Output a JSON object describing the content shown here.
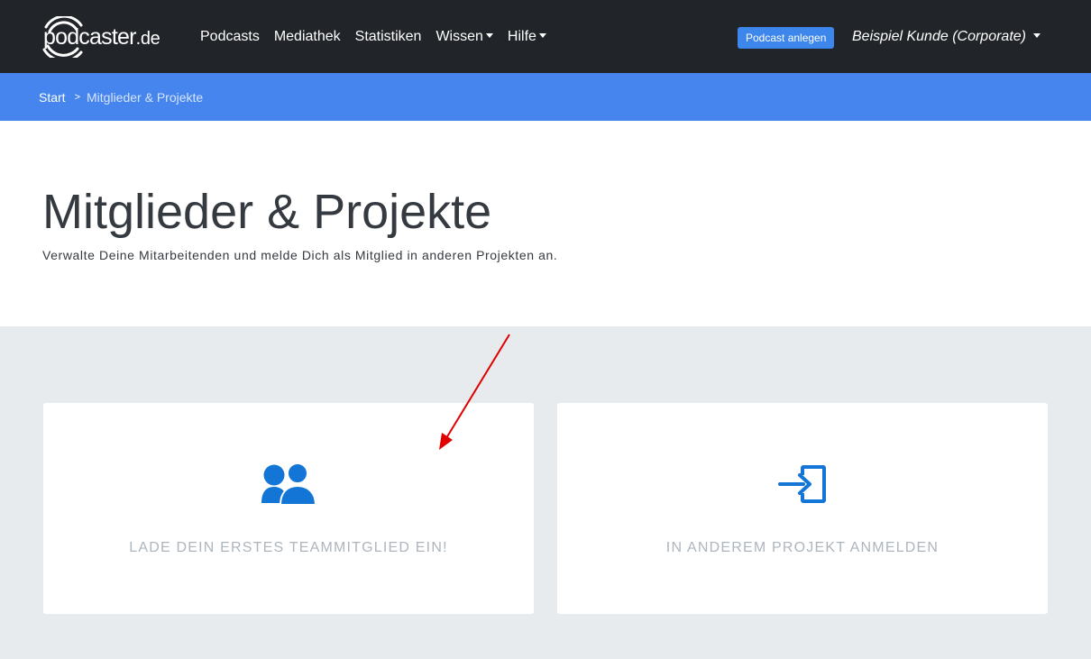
{
  "brand": {
    "name": "podcaster",
    "tld": ".de"
  },
  "nav": {
    "items": [
      {
        "label": "Podcasts",
        "dropdown": false
      },
      {
        "label": "Mediathek",
        "dropdown": false
      },
      {
        "label": "Statistiken",
        "dropdown": false
      },
      {
        "label": "Wissen",
        "dropdown": true
      },
      {
        "label": "Hilfe",
        "dropdown": true
      }
    ],
    "create_button": "Podcast anlegen",
    "account": "Beispiel Kunde (Corporate)"
  },
  "breadcrumb": {
    "home": "Start",
    "separator": ">",
    "current": "Mitglieder & Projekte"
  },
  "page": {
    "title": "Mitglieder & Projekte",
    "subtitle": "Verwalte Deine Mitarbeitenden und melde Dich als Mitglied in anderen Projekten an."
  },
  "cards": [
    {
      "label": "Lade dein erstes Teammitglied ein!",
      "icon": "users-icon"
    },
    {
      "label": "In anderem Projekt anmelden",
      "icon": "sign-in-icon"
    }
  ],
  "colors": {
    "navbar": "#212428",
    "breadcrumb_bar": "#4585ed",
    "accent_button": "#3d86ec",
    "icon_blue": "#1376d6",
    "annotation_arrow": "#e00000",
    "page_background": "#e8ebee"
  }
}
